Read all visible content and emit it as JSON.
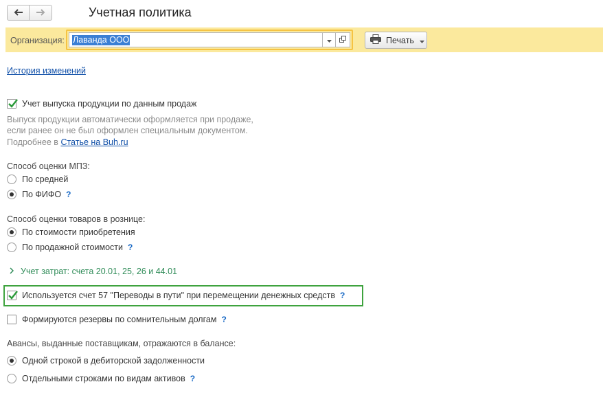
{
  "page": {
    "title": "Учетная политика"
  },
  "colors": {
    "header_bar": "#fbe99d",
    "field_focus": "#f5c343",
    "selection": "#3b7fd4",
    "link": "#0f4fa8",
    "help": "#1466c4",
    "expander": "#2e8b57",
    "highlight": "#3ea33e"
  },
  "icons": {
    "back": "arrow-left-icon",
    "forward": "arrow-right-icon",
    "dropdown": "chevron-down-icon",
    "open": "open-window-icon",
    "print": "printer-icon",
    "expander": "chevron-right-icon"
  },
  "header": {
    "org_label": "Организация:",
    "org_value": "Лаванда ООО",
    "print_label": "Печать"
  },
  "history_link": "История изменений",
  "output_by_sales": {
    "label": "Учет выпуска продукции по данным продаж",
    "checked": true,
    "hint_line1": "Выпуск продукции автоматически оформляется при продаже,",
    "hint_line2": "если ранее он не был оформлен специальным документом.",
    "more_prefix": "Подробнее в",
    "more_link": "Статье на Buh.ru"
  },
  "mpz": {
    "label": "Способ оценки МПЗ:",
    "options": [
      {
        "label": "По средней",
        "selected": false
      },
      {
        "label": "По ФИФО",
        "selected": true,
        "help": "?"
      }
    ]
  },
  "retail": {
    "label": "Способ оценки товаров в рознице:",
    "options": [
      {
        "label": "По стоимости приобретения",
        "selected": true
      },
      {
        "label": "По продажной стоимости",
        "selected": false,
        "help": "?"
      }
    ]
  },
  "cost_accounting": {
    "label": "Учет затрат: счета 20.01, 25, 26 и 44.01"
  },
  "account57": {
    "label": "Используется счет 57 \"Переводы в пути\" при перемещении денежных средств",
    "checked": true,
    "help": "?"
  },
  "doubtful_reserves": {
    "label": "Формируются резервы по сомнительным долгам",
    "checked": false,
    "help": "?"
  },
  "advances": {
    "label": "Авансы, выданные поставщикам, отражаются в балансе:",
    "options": [
      {
        "label": "Одной строкой в дебиторской задолженности",
        "selected": true
      },
      {
        "label": "Отдельными строками по видам активов",
        "selected": false,
        "help": "?"
      }
    ]
  }
}
